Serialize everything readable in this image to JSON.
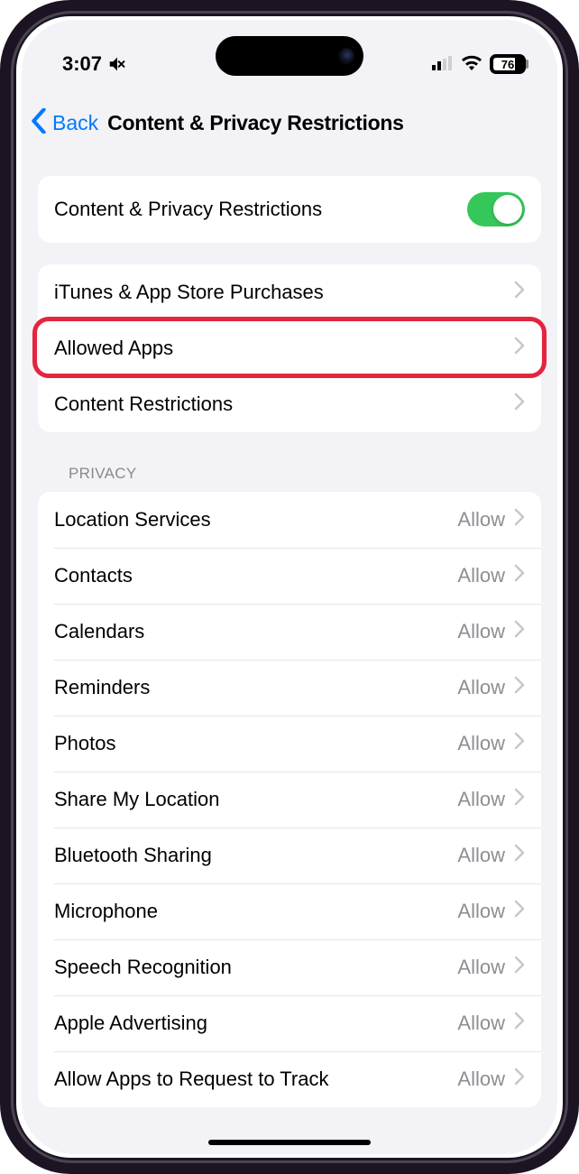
{
  "status": {
    "time": "3:07",
    "battery_pct": "76"
  },
  "nav": {
    "back_label": "Back",
    "title": "Content & Privacy Restrictions"
  },
  "toggle_row": {
    "label": "Content & Privacy Restrictions",
    "on": true
  },
  "main_rows": [
    {
      "label": "iTunes & App Store Purchases"
    },
    {
      "label": "Allowed Apps"
    },
    {
      "label": "Content Restrictions"
    }
  ],
  "privacy_header": "PRIVACY",
  "privacy_rows": [
    {
      "label": "Location Services",
      "value": "Allow"
    },
    {
      "label": "Contacts",
      "value": "Allow"
    },
    {
      "label": "Calendars",
      "value": "Allow"
    },
    {
      "label": "Reminders",
      "value": "Allow"
    },
    {
      "label": "Photos",
      "value": "Allow"
    },
    {
      "label": "Share My Location",
      "value": "Allow"
    },
    {
      "label": "Bluetooth Sharing",
      "value": "Allow"
    },
    {
      "label": "Microphone",
      "value": "Allow"
    },
    {
      "label": "Speech Recognition",
      "value": "Allow"
    },
    {
      "label": "Apple Advertising",
      "value": "Allow"
    },
    {
      "label": "Allow Apps to Request to Track",
      "value": "Allow"
    }
  ],
  "highlight_row_index": 1
}
